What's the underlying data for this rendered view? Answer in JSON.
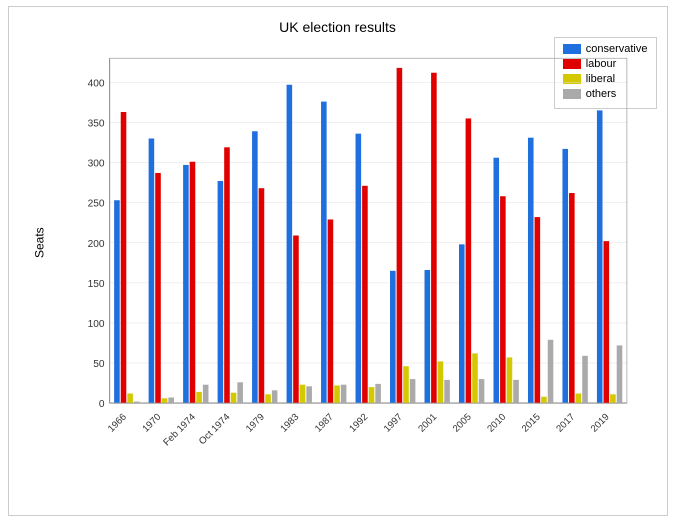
{
  "title": "UK election results",
  "yLabel": "Seats",
  "legend": {
    "items": [
      {
        "label": "conservative",
        "color": "#1f6fdf"
      },
      {
        "label": "labour",
        "color": "#e00000"
      },
      {
        "label": "liberal",
        "color": "#d4c800"
      },
      {
        "label": "others",
        "color": "#aaaaaa"
      }
    ]
  },
  "elections": [
    {
      "year": "1966",
      "conservative": 253,
      "labour": 363,
      "liberal": 12,
      "others": 2
    },
    {
      "year": "1970",
      "conservative": 330,
      "labour": 287,
      "liberal": 6,
      "others": 7
    },
    {
      "year": "Feb 1974",
      "conservative": 297,
      "labour": 301,
      "liberal": 14,
      "others": 23
    },
    {
      "year": "Oct 1974",
      "conservative": 277,
      "labour": 319,
      "liberal": 13,
      "others": 26
    },
    {
      "year": "1979",
      "conservative": 339,
      "labour": 268,
      "liberal": 11,
      "others": 16
    },
    {
      "year": "1983",
      "conservative": 397,
      "labour": 209,
      "liberal": 23,
      "others": 21
    },
    {
      "year": "1987",
      "conservative": 376,
      "labour": 229,
      "liberal": 22,
      "others": 23
    },
    {
      "year": "1992",
      "conservative": 336,
      "labour": 271,
      "liberal": 20,
      "others": 24
    },
    {
      "year": "1997",
      "conservative": 165,
      "labour": 418,
      "liberal": 46,
      "others": 30
    },
    {
      "year": "2001",
      "conservative": 166,
      "labour": 412,
      "liberal": 52,
      "others": 29
    },
    {
      "year": "2005",
      "conservative": 198,
      "labour": 355,
      "liberal": 62,
      "others": 30
    },
    {
      "year": "2010",
      "conservative": 306,
      "labour": 258,
      "liberal": 57,
      "others": 29
    },
    {
      "year": "2015",
      "conservative": 331,
      "labour": 232,
      "liberal": 8,
      "others": 79
    },
    {
      "year": "2017",
      "conservative": 317,
      "labour": 262,
      "liberal": 12,
      "others": 59
    },
    {
      "year": "2019",
      "conservative": 365,
      "labour": 202,
      "liberal": 11,
      "others": 72
    }
  ],
  "yAxis": {
    "max": 430,
    "ticks": [
      0,
      50,
      100,
      150,
      200,
      250,
      300,
      350,
      400
    ]
  }
}
